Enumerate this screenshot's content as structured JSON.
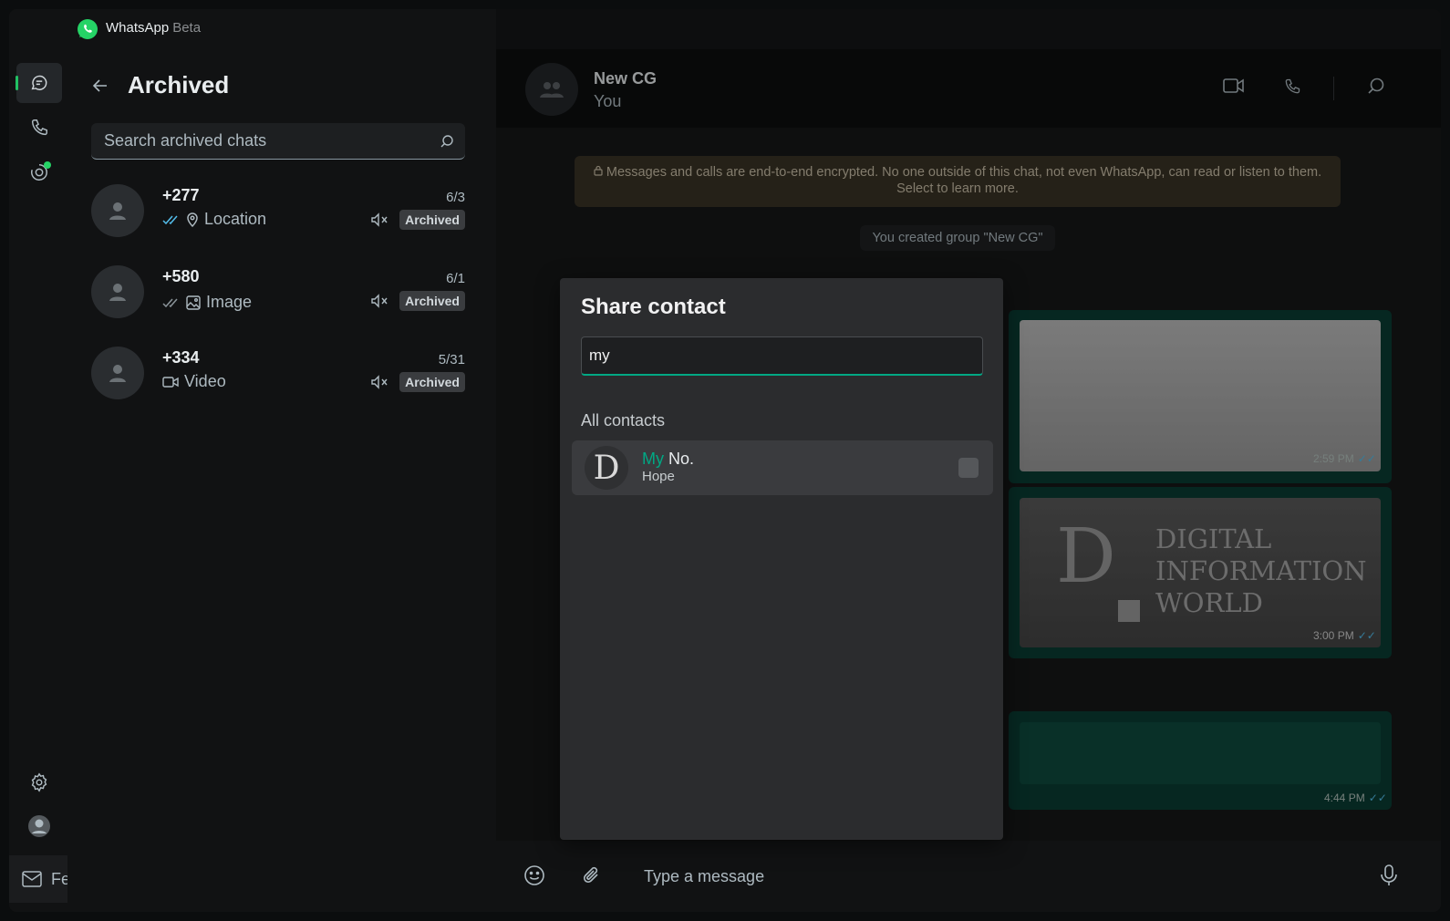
{
  "app": {
    "name": "WhatsApp",
    "suffix": "Beta"
  },
  "window_controls": {
    "minimize_icon": "minimize-icon",
    "maximize_icon": "maximize-icon",
    "close_icon": "close-icon"
  },
  "rail": {
    "items": [
      "chats-icon",
      "calls-icon",
      "status-icon"
    ],
    "bottom": [
      "settings-icon",
      "profile-icon"
    ]
  },
  "feedback": {
    "label": "Feedback"
  },
  "archived": {
    "title": "Archived",
    "search_placeholder": "Search archived chats",
    "chats": [
      {
        "name": "+277",
        "date": "6/3",
        "preview": "Location",
        "badge": "Archived",
        "ticks": "read",
        "media_icon": "location-pin-icon"
      },
      {
        "name": "+580",
        "date": "6/1",
        "preview": "Image",
        "badge": "Archived",
        "ticks": "delivered",
        "media_icon": "image-icon"
      },
      {
        "name": "+334",
        "date": "5/31",
        "preview": "Video",
        "badge": "Archived",
        "ticks": "none",
        "media_icon": "video-icon"
      }
    ]
  },
  "conversation": {
    "name": "New CG",
    "subtitle": "You",
    "encryption_line1": "Messages and calls are end-to-end encrypted. No one outside of this chat, not even WhatsApp, can read or listen to them.",
    "encryption_line2": "Select to learn more.",
    "system_message": "You created group \"New CG\"",
    "messages": [
      {
        "type": "image",
        "time": "2:59 PM"
      },
      {
        "type": "image",
        "time": "3:00 PM",
        "logo_letter": "D",
        "logo_text": [
          "DIGITAL",
          "INFORMATION",
          "WORLD"
        ]
      },
      {
        "type": "contact",
        "time": "4:44 PM"
      }
    ],
    "composer_placeholder": "Type a message"
  },
  "share_contact": {
    "title": "Share contact",
    "search_value": "my",
    "section": "All contacts",
    "contacts": [
      {
        "initial": "D",
        "name_highlight": "My",
        "name_rest": " No.",
        "subtitle": "Hope",
        "checked": false
      }
    ]
  },
  "colors": {
    "accent": "#00a884",
    "online_dot": "#25d366",
    "bubble_out": "#0a3d33",
    "read_ticks": "#53bdeb"
  }
}
